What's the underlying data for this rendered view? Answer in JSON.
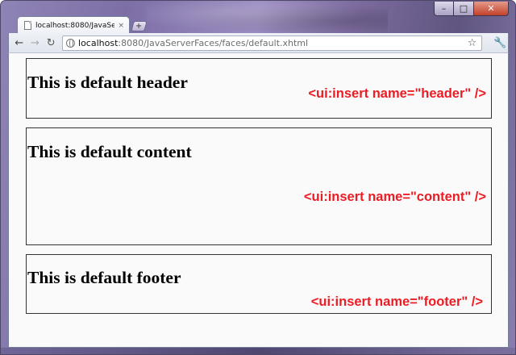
{
  "window": {
    "controls": {
      "minimize": "–",
      "maximize": "□",
      "close": "✕"
    }
  },
  "tab": {
    "title": "localhost:8080/JavaServer...",
    "close_glyph": "×",
    "icon": "page-icon"
  },
  "new_tab": {
    "label": "+"
  },
  "toolbar": {
    "back_glyph": "←",
    "forward_glyph": "→",
    "reload_glyph": "↻",
    "url_host": "localhost",
    "url_path": ":8080/JavaServerFaces/faces/default.xhtml",
    "star_glyph": "☆",
    "wrench_glyph": "🔧"
  },
  "page": {
    "header": {
      "heading": "This is default header",
      "note": "<ui:insert name=\"header\" />"
    },
    "content": {
      "heading": "This is default content",
      "note": "<ui:insert name=\"content\" />"
    },
    "footer": {
      "heading": "This is default footer",
      "note": "<ui:insert name=\"footer\" />"
    }
  },
  "colors": {
    "note_red": "#ec1c24",
    "page_bg": "#fafafa",
    "frame": "#7d6fa6"
  }
}
